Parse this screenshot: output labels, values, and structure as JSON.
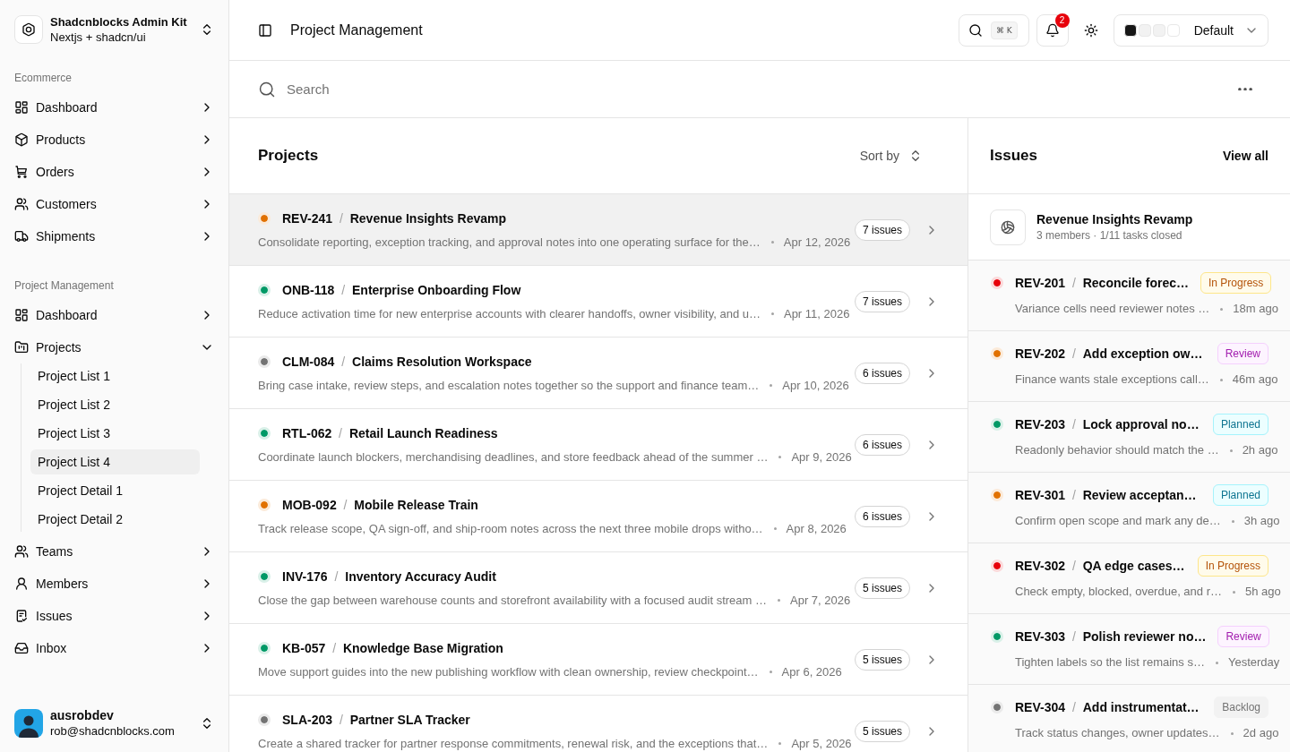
{
  "sidebar": {
    "workspace": {
      "name": "Shadcnblocks Admin Kit",
      "subtitle": "Nextjs + shadcn/ui"
    },
    "groups": [
      {
        "label": "Ecommerce",
        "items": [
          {
            "label": "Dashboard",
            "expanded": false
          },
          {
            "label": "Products",
            "expanded": false
          },
          {
            "label": "Orders",
            "expanded": false
          },
          {
            "label": "Customers",
            "expanded": false
          },
          {
            "label": "Shipments",
            "expanded": false
          }
        ]
      },
      {
        "label": "Project Management",
        "items": [
          {
            "label": "Dashboard",
            "expanded": false
          },
          {
            "label": "Projects",
            "expanded": true,
            "children": [
              {
                "label": "Project List 1",
                "selected": false
              },
              {
                "label": "Project List 2",
                "selected": false
              },
              {
                "label": "Project List 3",
                "selected": false
              },
              {
                "label": "Project List 4",
                "selected": true
              },
              {
                "label": "Project Detail 1",
                "selected": false
              },
              {
                "label": "Project Detail 2",
                "selected": false
              }
            ]
          },
          {
            "label": "Teams",
            "expanded": false
          },
          {
            "label": "Members",
            "expanded": false
          },
          {
            "label": "Issues",
            "expanded": false
          },
          {
            "label": "Inbox",
            "expanded": false
          }
        ]
      }
    ],
    "user": {
      "name": "ausrobdev",
      "email": "rob@shadcnblocks.com"
    }
  },
  "header": {
    "title": "Project Management",
    "search_shortcut": "⌘ K",
    "notification_count": "2",
    "theme": {
      "swatches": [
        {
          "color": "#171717"
        },
        {
          "color": "#f2f2f2"
        },
        {
          "color": "#f2f2f2"
        },
        {
          "color": "#ffffff"
        }
      ],
      "value": "Default"
    }
  },
  "search": {
    "placeholder": "Search"
  },
  "projects": {
    "title": "Projects",
    "sort_label": "Sort by",
    "rows": [
      {
        "selected": true,
        "color": "#e17100",
        "title": "**REV-241** / **Revenue Insights Revamp**",
        "description": "Consolidate reporting, exception tracking, and approval notes into one operating surface for the…",
        "date": "Apr 12, 2026",
        "issues": "7 issues"
      },
      {
        "selected": false,
        "color": "#009966",
        "title": "**ONB-118** / **Enterprise Onboarding Flow**",
        "description": "Reduce activation time for new enterprise accounts with clearer handoffs, owner visibility, and u…",
        "date": "Apr 11, 2026",
        "issues": "7 issues"
      },
      {
        "selected": false,
        "color": "#737373",
        "title": "**CLM-084** / **Claims Resolution Workspace**",
        "description": "Bring case intake, review steps, and escalation notes together so the support and finance team…",
        "date": "Apr 10, 2026",
        "issues": "6 issues"
      },
      {
        "selected": false,
        "color": "#009966",
        "title": "**RTL-062** / **Retail Launch Readiness**",
        "description": "Coordinate launch blockers, merchandising deadlines, and store feedback ahead of the summer …",
        "date": "Apr 9, 2026",
        "issues": "6 issues"
      },
      {
        "selected": false,
        "color": "#e17100",
        "title": "**MOB-092** / **Mobile Release Train**",
        "description": "Track release scope, QA sign-off, and ship-room notes across the next three mobile drops witho…",
        "date": "Apr 8, 2026",
        "issues": "6 issues"
      },
      {
        "selected": false,
        "color": "#009966",
        "title": "**INV-176** / **Inventory Accuracy Audit**",
        "description": "Close the gap between warehouse counts and storefront availability with a focused audit stream …",
        "date": "Apr 7, 2026",
        "issues": "5 issues"
      },
      {
        "selected": false,
        "color": "#009966",
        "title": "**KB-057** / **Knowledge Base Migration**",
        "description": "Move support guides into the new publishing workflow with clean ownership, review checkpoint…",
        "date": "Apr 6, 2026",
        "issues": "5 issues"
      },
      {
        "selected": false,
        "color": "#737373",
        "title": "**SLA-203** / **Partner SLA Tracker**",
        "description": "Create a shared tracker for partner response commitments, renewal risk, and the exceptions that…",
        "date": "Apr 5, 2026",
        "issues": "5 issues"
      }
    ]
  },
  "issues": {
    "title": "Issues",
    "view_all": "View all",
    "project": {
      "name": "Revenue Insights Revamp",
      "meta": "3 members · 1/11 tasks closed"
    },
    "items": [
      {
        "color": "#e7000b",
        "title": "**REV-201** / **Reconcile forec…**",
        "status": {
          "kind": "in_progress",
          "label": "In Progress"
        },
        "description": "Variance cells need reviewer notes …",
        "time": "18m ago"
      },
      {
        "color": "#e17100",
        "title": "**REV-202** / **Add exception ow…**",
        "status": {
          "kind": "review",
          "label": "Review"
        },
        "description": "Finance wants stale exceptions call…",
        "time": "46m ago"
      },
      {
        "color": "#009966",
        "title": "**REV-203** / **Lock approval no…**",
        "status": {
          "kind": "planned",
          "label": "Planned"
        },
        "description": "Readonly behavior should match the …",
        "time": "2h ago"
      },
      {
        "color": "#e17100",
        "title": "**REV-301** / **Review acceptan…**",
        "status": {
          "kind": "planned",
          "label": "Planned"
        },
        "description": "Confirm open scope and mark any de…",
        "time": "3h ago"
      },
      {
        "color": "#e7000b",
        "title": "**REV-302** / **QA edge cases…**",
        "status": {
          "kind": "in_progress",
          "label": "In Progress"
        },
        "description": "Check empty, blocked, overdue, and r…",
        "time": "5h ago"
      },
      {
        "color": "#009966",
        "title": "**REV-303** / **Polish reviewer no…**",
        "status": {
          "kind": "review",
          "label": "Review"
        },
        "description": "Tighten labels so the list remains s…",
        "time": "Yesterday"
      },
      {
        "color": "#737373",
        "title": "**REV-304** / **Add instrumentat…**",
        "status": {
          "kind": "backlog",
          "label": "Backlog"
        },
        "description": "Track status changes, owner updates…",
        "time": "2d ago"
      }
    ]
  }
}
